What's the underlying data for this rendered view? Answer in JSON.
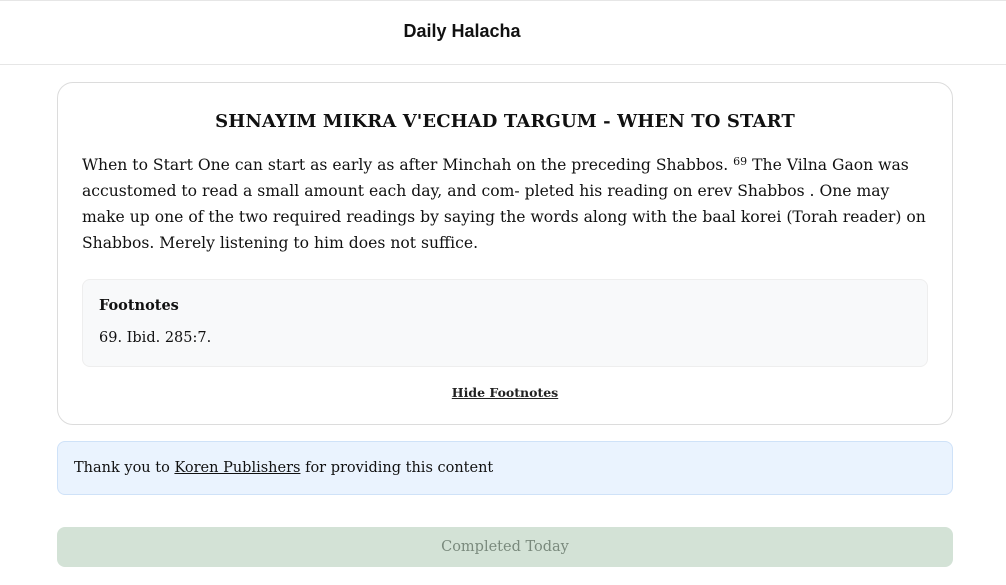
{
  "header": {
    "title": "Daily Halacha"
  },
  "article": {
    "title": "SHNAYIM MIKRA V'ECHAD TARGUM - WHEN TO START",
    "body_before_ref": "When to Start One can start as early as after Minchah on the preceding Shabbos. ",
    "footnote_ref": "69",
    "body_after_ref": " The Vilna Gaon was accustomed to read a small amount each day, and com- pleted his reading on erev Shabbos . One may make up one of the two required readings by saying the words along with the baal korei (Torah reader) on Shabbos. Merely listening to him does not suffice."
  },
  "footnotes": {
    "heading": "Footnotes",
    "items": [
      "69. Ibid. 285:7."
    ],
    "toggle_label": "Hide Footnotes"
  },
  "credit": {
    "prefix": "Thank you to ",
    "publisher": "Koren Publishers",
    "suffix": " for providing this content"
  },
  "status": {
    "completed_label": "Completed Today"
  }
}
